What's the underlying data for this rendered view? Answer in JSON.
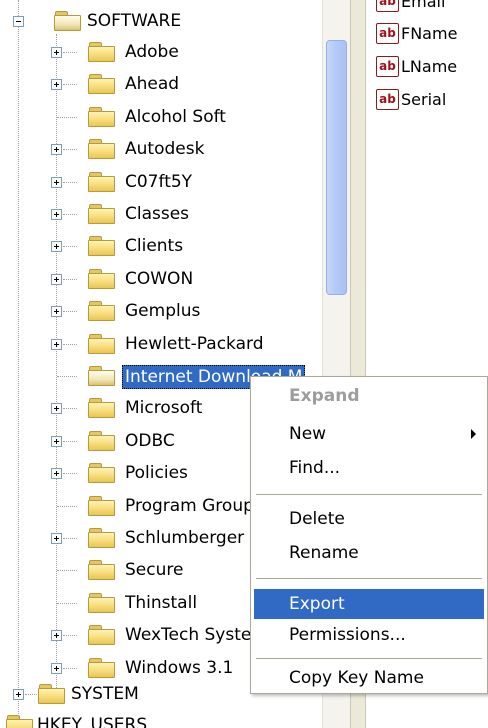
{
  "tree": {
    "root_label": "SOFTWARE",
    "children": [
      {
        "label": "Adobe",
        "expandable": true
      },
      {
        "label": "Ahead",
        "expandable": true
      },
      {
        "label": "Alcohol Soft",
        "expandable": false
      },
      {
        "label": "Autodesk",
        "expandable": true
      },
      {
        "label": "C07ft5Y",
        "expandable": true
      },
      {
        "label": "Classes",
        "expandable": true
      },
      {
        "label": "Clients",
        "expandable": true
      },
      {
        "label": "COWON",
        "expandable": true
      },
      {
        "label": "Gemplus",
        "expandable": true
      },
      {
        "label": "Hewlett-Packard",
        "expandable": true
      },
      {
        "label": "Internet Download M",
        "expandable": false,
        "selected": true
      },
      {
        "label": "Microsoft",
        "expandable": true
      },
      {
        "label": "ODBC",
        "expandable": true
      },
      {
        "label": "Policies",
        "expandable": true
      },
      {
        "label": "Program Groups",
        "expandable": false
      },
      {
        "label": "Schlumberger",
        "expandable": true
      },
      {
        "label": "Secure",
        "expandable": false
      },
      {
        "label": "Thinstall",
        "expandable": false
      },
      {
        "label": "WexTech Systems",
        "expandable": true
      },
      {
        "label": "Windows 3.1",
        "expandable": true
      }
    ],
    "system_label": "SYSTEM",
    "hkey_users_label": "HKEY_USERS"
  },
  "values": [
    {
      "label": "Email",
      "icon": "ab"
    },
    {
      "label": "FName",
      "icon": "ab"
    },
    {
      "label": "LName",
      "icon": "ab"
    },
    {
      "label": "Serial",
      "icon": "ab"
    }
  ],
  "context_menu": {
    "expand": "Expand",
    "new": "New",
    "find": "Find...",
    "delete": "Delete",
    "rename": "Rename",
    "export": "Export",
    "permissions": "Permissions...",
    "copy_key_name": "Copy Key Name"
  },
  "colors": {
    "selection": "#316ac5",
    "folder": "#f7dc7a"
  }
}
